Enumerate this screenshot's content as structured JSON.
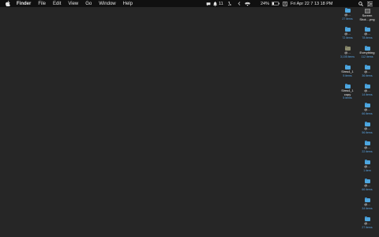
{
  "menubar": {
    "app_name": "Finder",
    "menus": [
      "File",
      "Edit",
      "View",
      "Go",
      "Window",
      "Help"
    ],
    "status": {
      "notification_count": "11",
      "battery_percent": "24%",
      "datetime": "Fri Apr 22  7 13 18 PM"
    },
    "icons": [
      "apple-icon",
      "app-status-icon",
      "bell-icon",
      "moon-icon",
      "chevron-icon",
      "wifi-icon",
      "battery-icon",
      "input-source-icon",
      "search-icon",
      "control-center-icon"
    ]
  },
  "desktop": {
    "column_right": [
      {
        "label": "Screen\nShot....png",
        "sub": "",
        "kind": "file"
      },
      {
        "label": "@...",
        "sub": "78 items",
        "kind": "folder"
      },
      {
        "label": "Everything",
        "sub": "112 items",
        "kind": "folder"
      },
      {
        "label": "@...",
        "sub": "36 items",
        "kind": "folder"
      },
      {
        "label": "@...",
        "sub": "14 items",
        "kind": "folder"
      },
      {
        "label": "@...",
        "sub": "66 items",
        "kind": "folder"
      },
      {
        "label": "@...",
        "sub": "56 items",
        "kind": "folder"
      },
      {
        "label": "@...",
        "sub": "22 items",
        "kind": "folder"
      },
      {
        "label": "@...",
        "sub": "1 item",
        "kind": "folder"
      },
      {
        "label": "@...",
        "sub": "66 items",
        "kind": "folder"
      },
      {
        "label": "@...",
        "sub": "34 items",
        "kind": "folder"
      },
      {
        "label": "@...",
        "sub": "27 items",
        "kind": "folder"
      }
    ],
    "column_left": [
      {
        "label": "@...",
        "sub": "27 items",
        "kind": "folder"
      },
      {
        "label": "@...",
        "sub": "72 items",
        "kind": "folder"
      },
      {
        "label": "@...",
        "sub": "3,105 items",
        "kind": "folder-dark"
      },
      {
        "label": "Sims4_1",
        "sub": "5 items",
        "kind": "folder"
      },
      {
        "label": "Sims4_1\ncopy",
        "sub": "5 items",
        "kind": "folder"
      }
    ]
  },
  "colors": {
    "desktop_bg": "#262626",
    "menubar_bg": "#101010",
    "folder_blue": "#4ea7e0",
    "item_count_blue": "#5ca8e8"
  }
}
